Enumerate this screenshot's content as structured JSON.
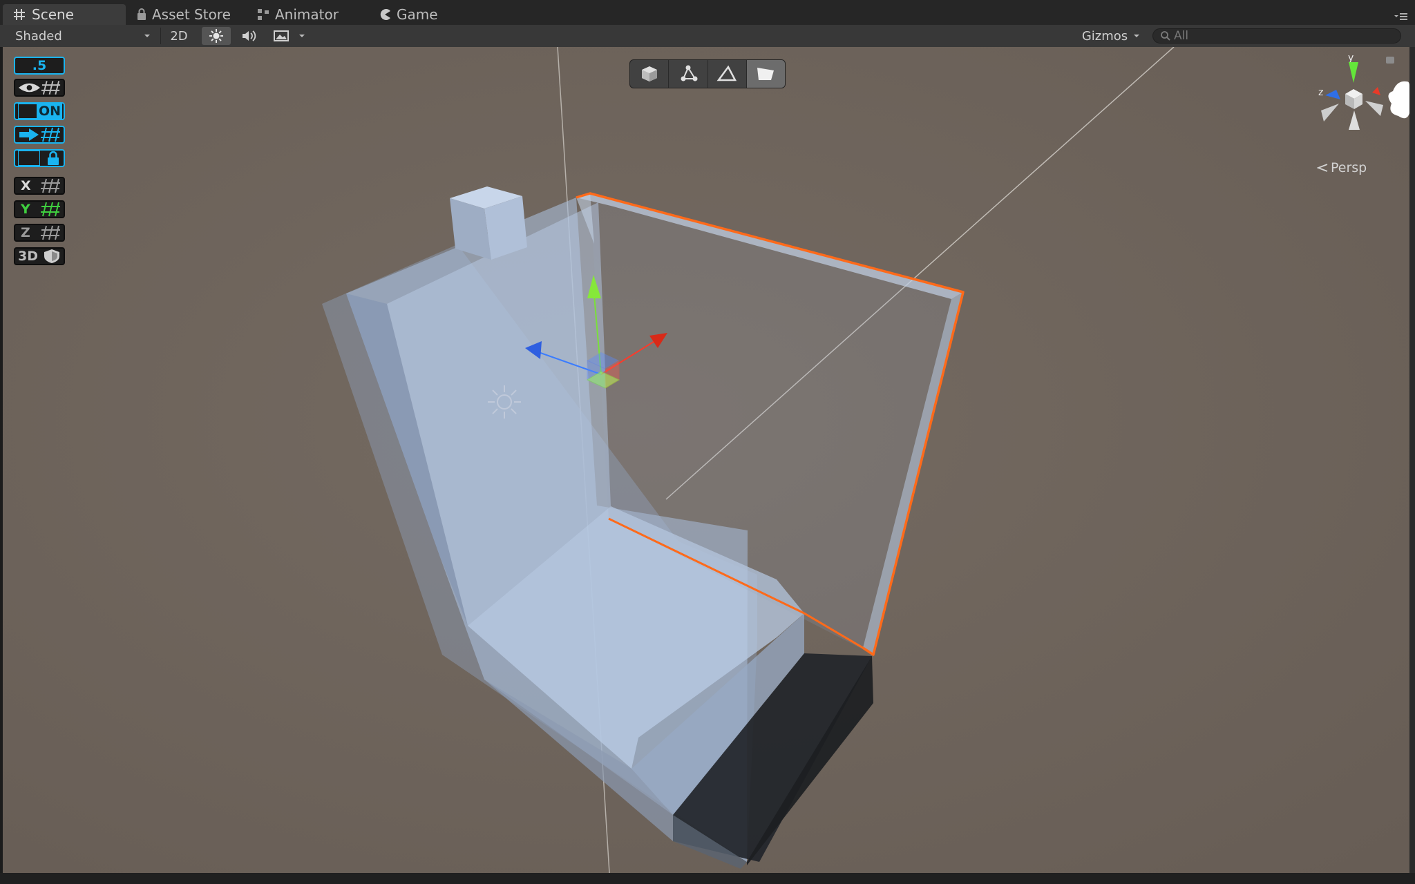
{
  "tabs": {
    "scene": "Scene",
    "asset_store": "Asset Store",
    "animator": "Animator",
    "game": "Game"
  },
  "toolbar": {
    "draw_mode": "Shaded",
    "mode_2d": "2D",
    "gizmos": "Gizmos",
    "search_placeholder": "All",
    "icons": [
      "sun-icon",
      "speaker-icon",
      "image-icon",
      "chevron-down-icon"
    ]
  },
  "snap_panel": {
    "grid_size": ".5",
    "on_label": "ON",
    "x_label": "X",
    "y_label": "Y",
    "z_label": "Z",
    "mode_3d_label": "3D"
  },
  "tool_modes": [
    "cube-icon",
    "vertex-icon",
    "edge-icon",
    "face-icon"
  ],
  "scene_gizmo": {
    "y_label": "y",
    "z_label": "z",
    "projection": "Persp"
  },
  "colors": {
    "accent_blue": "#1ab4f0",
    "selection_orange": "#ff6a1a",
    "viewport_bg": "#6f655c",
    "y_green": "#3fcf3f"
  }
}
